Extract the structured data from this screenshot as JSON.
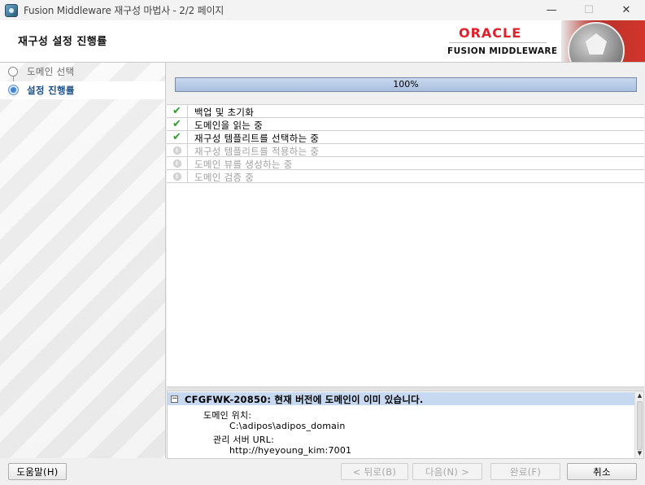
{
  "window": {
    "title": "Fusion Middleware 재구성 마법사 - 2/2 페이지",
    "minimize_glyph": "—",
    "maximize_glyph": "☐",
    "close_glyph": "✕"
  },
  "header": {
    "title": "재구성 설정 진행률",
    "brand_top": "ORACLE",
    "brand_bottom": "FUSION MIDDLEWARE"
  },
  "nav": {
    "items": [
      {
        "label": "도메인 선택",
        "state": "done"
      },
      {
        "label": "설정 진행률",
        "state": "current"
      }
    ]
  },
  "progress": {
    "value": 1.0,
    "label": "100%"
  },
  "tasks": [
    {
      "label": "백업 및 초기화",
      "status": "done"
    },
    {
      "label": "도메인을 읽는 중",
      "status": "done"
    },
    {
      "label": "재구성 템플리트를 선택하는 중",
      "status": "done"
    },
    {
      "label": "재구성 템플리트를 적용하는 중",
      "status": "pending"
    },
    {
      "label": "도메인 뷰를 생성하는 중",
      "status": "pending"
    },
    {
      "label": "도메인 검증 중",
      "status": "pending"
    }
  ],
  "log": {
    "collapse_glyph": "−",
    "title": "CFGFWK-20850: 현재 버전에 도메인이 이미 있습니다.",
    "lines": [
      {
        "text": "도메인 위치:"
      },
      {
        "text": "C:\\adipos\\adipos_domain"
      },
      {
        "text": "관리 서버 URL:"
      },
      {
        "text": "http://hyeyoung_kim:7001"
      }
    ]
  },
  "buttons": {
    "help": "도움말(H)",
    "back": "< 뒤로(B)",
    "next": "다음(N) >",
    "finish": "완료(F)",
    "cancel": "취소"
  },
  "colors": {
    "oracle_red": "#e0202a",
    "selection_blue": "#c7d9f1",
    "check_green": "#2f9a2f"
  }
}
